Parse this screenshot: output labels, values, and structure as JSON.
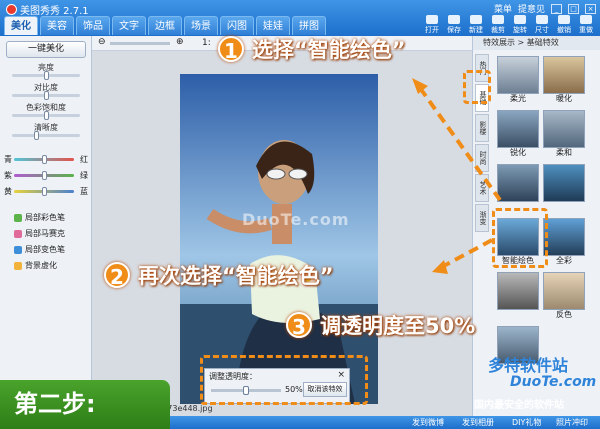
{
  "app": {
    "title": "美图秀秀 2.7.1"
  },
  "header": {
    "tabs": [
      "美化",
      "美容",
      "饰品",
      "文字",
      "边框",
      "场景",
      "闪图",
      "娃娃",
      "拼图"
    ],
    "active_tab": "美化",
    "links": [
      "菜单",
      "提意见"
    ],
    "tools": [
      "打开",
      "保存",
      "新建",
      "裁剪",
      "旋转",
      "尺寸",
      "撤销",
      "重做"
    ]
  },
  "left": {
    "one_key_label": "一键美化",
    "sliders": [
      {
        "label": "亮度",
        "value": 0.5
      },
      {
        "label": "对比度",
        "value": 0.5
      },
      {
        "label": "色彩饱和度",
        "value": 0.5
      },
      {
        "label": "清晰度",
        "value": 0.35
      }
    ],
    "color_balance": [
      {
        "left": "青",
        "right": "红",
        "value": 0.5,
        "color": "#e6524b"
      },
      {
        "left": "紫",
        "right": "绿",
        "value": 0.5,
        "color": "#5bb34a"
      },
      {
        "left": "黄",
        "right": "蓝",
        "value": 0.5,
        "color": "#4a7fd0"
      }
    ],
    "brushes": [
      "局部彩色笔",
      "局部马赛克",
      "局部变色笔",
      "背景虚化"
    ]
  },
  "canvas": {
    "zoom_text": "1:",
    "watermark": "DuoTe.com",
    "filename": "57473e448.jpg",
    "overlay": {
      "title": "调整透明度：",
      "close": "×",
      "value_text": "50%",
      "value": 0.5,
      "cancel_label": "取消该特效"
    }
  },
  "right": {
    "header": "特效展示 > 基础特效",
    "vtabs": [
      "热门",
      "基础",
      "影楼",
      "时尚",
      "艺术",
      "渐变"
    ],
    "effects": [
      "柔光",
      "暖化",
      "锐化",
      "柔和",
      "",
      "",
      "智能绘色",
      "全彩",
      "",
      "反色",
      "",
      "",
      ""
    ]
  },
  "annotations": {
    "step1": "选择“智能绘色”",
    "step2": "再次选择“智能绘色”",
    "step3": "调透明度至50%",
    "num1": "1",
    "num2": "2",
    "num3": "3",
    "step_label": "第二步:"
  },
  "status": {
    "items": [
      "发到微博",
      "发到相册",
      "DIY礼物",
      "照片冲印"
    ]
  },
  "brand": {
    "name": "多特软件站",
    "site": "DuoTe.com",
    "slogan": "国内最安全的软件站"
  },
  "colors": {
    "accent": "#f08c18",
    "titlebar": "#2f84da",
    "step_bg": "#3b9222"
  }
}
